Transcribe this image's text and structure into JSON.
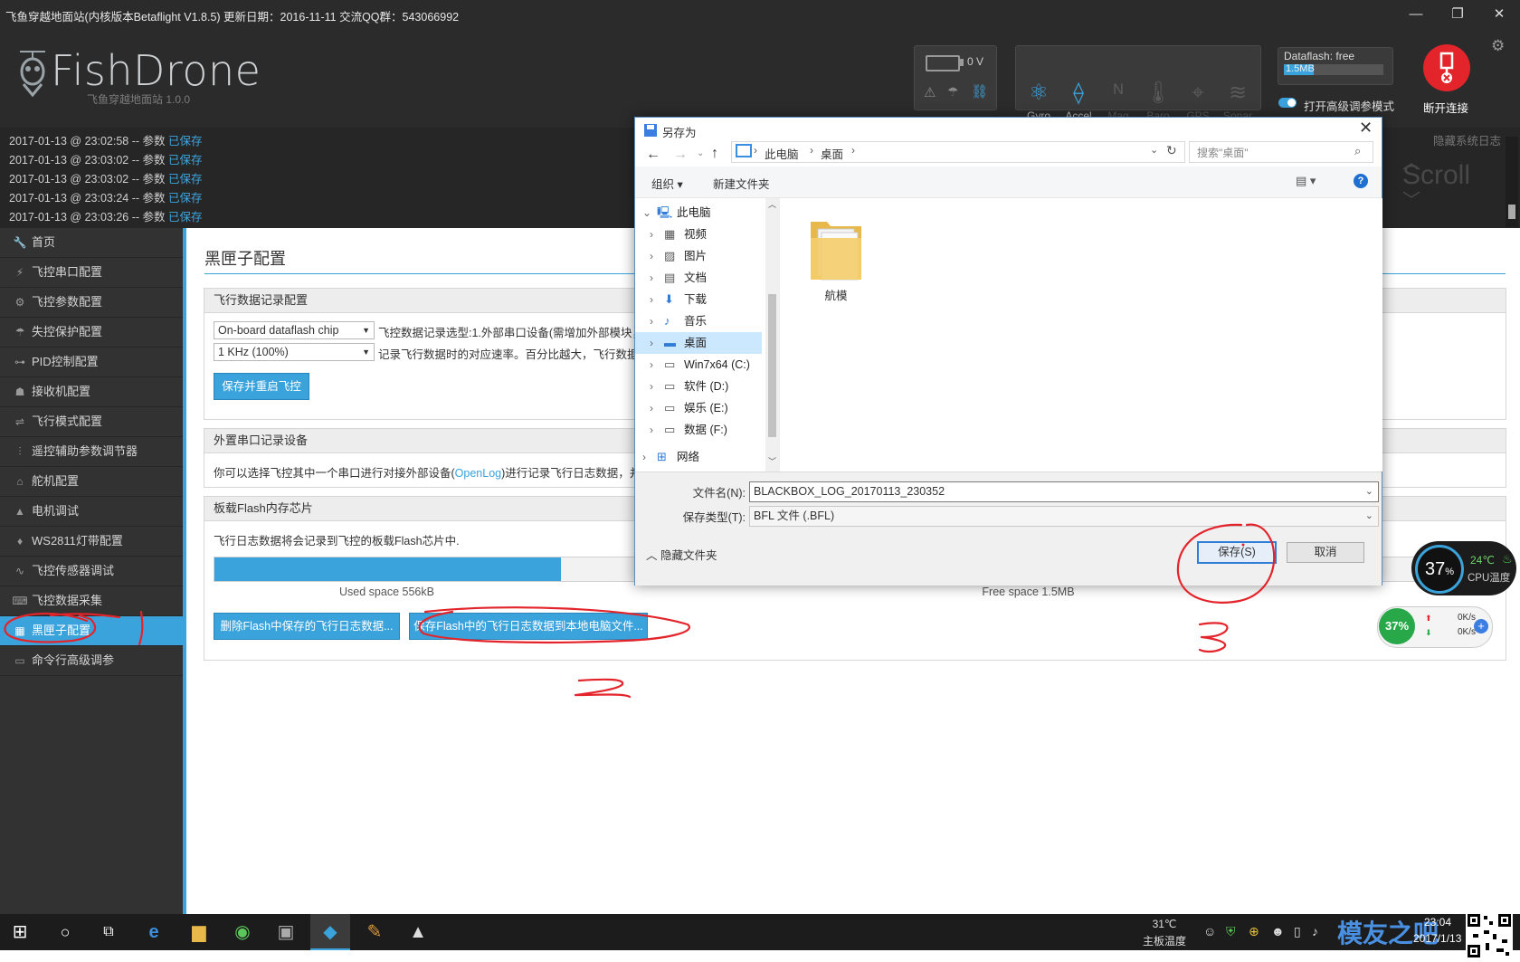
{
  "window": {
    "title": "飞鱼穿越地面站(内核版本Betaflight V1.8.5)   更新日期：2016-11-11  交流QQ群：543066992",
    "minimize": "—",
    "maximize": "❐",
    "close": "✕"
  },
  "header": {
    "logo_text": "FishDrone",
    "logo_sub": "飞鱼穿越地面站     1.0.0",
    "battery_voltage": "0 V",
    "sensors": [
      {
        "label": "Gyro",
        "icon": "gyro-icon",
        "active": true
      },
      {
        "label": "Accel",
        "icon": "accel-icon",
        "active": true
      },
      {
        "label": "Mag",
        "icon": "mag-icon",
        "active": false
      },
      {
        "label": "Baro",
        "icon": "baro-icon",
        "active": false
      },
      {
        "label": "GPS",
        "icon": "gps-icon",
        "active": false
      },
      {
        "label": "Sonar",
        "icon": "sonar-icon",
        "active": false
      }
    ],
    "dataflash_label": "Dataflash: free",
    "dataflash_value": "1.5MB",
    "expert_mode_label": "打开高级调参模式",
    "disconnect_label": "断开连接",
    "hide_log_label": "隐藏系统日志",
    "scroll_label": "Scroll"
  },
  "log": [
    {
      "time": "2017-01-13 @ 23:02:58",
      "text": " -- 参数 ",
      "status": "已保存"
    },
    {
      "time": "2017-01-13 @ 23:03:02",
      "text": " -- 参数 ",
      "status": "已保存"
    },
    {
      "time": "2017-01-13 @ 23:03:02",
      "text": " -- 参数 ",
      "status": "已保存"
    },
    {
      "time": "2017-01-13 @ 23:03:24",
      "text": " -- 参数 ",
      "status": "已保存"
    },
    {
      "time": "2017-01-13 @ 23:03:26",
      "text": " -- 参数 ",
      "status": "已保存"
    }
  ],
  "sidebar": [
    {
      "label": "首页",
      "icon": "wrench-icon"
    },
    {
      "label": "飞控串口配置",
      "icon": "plug-icon"
    },
    {
      "label": "飞控参数配置",
      "icon": "gear-icon"
    },
    {
      "label": "失控保护配置",
      "icon": "parachute-icon"
    },
    {
      "label": "PID控制配置",
      "icon": "sitemap-icon"
    },
    {
      "label": "接收机配置",
      "icon": "robot-icon"
    },
    {
      "label": "飞行模式配置",
      "icon": "toggle-icon"
    },
    {
      "label": "遥控辅助参数调节器",
      "icon": "sliders-icon"
    },
    {
      "label": "舵机配置",
      "icon": "servo-icon"
    },
    {
      "label": "电机调试",
      "icon": "motor-icon"
    },
    {
      "label": "WS2811灯带配置",
      "icon": "led-icon"
    },
    {
      "label": "飞控传感器调试",
      "icon": "pulse-icon"
    },
    {
      "label": "飞控数据采集",
      "icon": "keyboard-icon"
    },
    {
      "label": "黑匣子配置",
      "icon": "blackbox-icon",
      "active": true
    },
    {
      "label": "命令行高级调参",
      "icon": "terminal-icon"
    }
  ],
  "content": {
    "page_title": "黑匣子配置",
    "section1": {
      "title": "飞行数据记录配置",
      "device_select": "On-board dataflash chip",
      "device_desc": "飞控数据记录选型:1.外部串口设备(需增加外部模块，",
      "rate_select": "1 KHz (100%)",
      "rate_desc": "记录飞行数据时的对应速率。百分比越大，飞行数据",
      "save_reboot": "保存并重启飞控"
    },
    "section2": {
      "title": "外置串口记录设备",
      "desc_a": "你可以选择飞控其中一个串口进行对接外部设备(",
      "desc_link": "OpenLog",
      "desc_b": ")进行记录飞行日志数据，并在"
    },
    "section3": {
      "title": "板载Flash内存芯片",
      "desc": "飞行日志数据将会记录到飞控的板载Flash芯片中.",
      "used_fraction": 0.27,
      "used_label": "Used space 556kB",
      "free_label": "Free space 1.5MB",
      "erase_button": "删除Flash中保存的飞行日志数据...",
      "save_button": "保存Flash中的飞行日志数据到本地电脑文件..."
    }
  },
  "dialog": {
    "title": "另存为",
    "path": [
      "此电脑",
      "桌面"
    ],
    "search_placeholder": "搜索\"桌面\"",
    "organize": "组织",
    "new_folder": "新建文件夹",
    "tree": [
      {
        "label": "此电脑",
        "icon": "pc-icon",
        "level": 0,
        "expanded": true
      },
      {
        "label": "视频",
        "icon": "video-icon",
        "level": 1
      },
      {
        "label": "图片",
        "icon": "picture-icon",
        "level": 1
      },
      {
        "label": "文档",
        "icon": "document-icon",
        "level": 1
      },
      {
        "label": "下载",
        "icon": "download-icon",
        "level": 1
      },
      {
        "label": "音乐",
        "icon": "music-icon",
        "level": 1
      },
      {
        "label": "桌面",
        "icon": "desktop-icon",
        "level": 1,
        "selected": true
      },
      {
        "label": "Win7x64 (C:)",
        "icon": "drive-icon",
        "level": 1
      },
      {
        "label": "软件 (D:)",
        "icon": "drive-icon",
        "level": 1
      },
      {
        "label": "娱乐 (E:)",
        "icon": "drive-icon",
        "level": 1
      },
      {
        "label": "数据 (F:)",
        "icon": "drive-icon",
        "level": 1
      },
      {
        "label": "网络",
        "icon": "network-icon",
        "level": 0
      }
    ],
    "folder_name": "航模",
    "filename_label": "文件名(N):",
    "filename_value": "BLACKBOX_LOG_20170113_230352",
    "filetype_label": "保存类型(T):",
    "filetype_value": "BFL 文件 (.BFL)",
    "hide_folders": "隐藏文件夹",
    "save": "保存(S)",
    "cancel": "取消"
  },
  "widgets": {
    "cpu_percent": "37",
    "cpu_unit": "%",
    "cpu_temp": "24℃",
    "cpu_temp_label": "CPU温度",
    "net_percent": "37%",
    "up_speed": "0K/s",
    "down_speed": "0K/s"
  },
  "annotations": [
    "1",
    "2",
    "3"
  ],
  "taskbar": {
    "temp": "31℃",
    "temp_label": "主板温度",
    "time": "23:04",
    "date": "2017/1/13",
    "watermark": "模友之吧"
  },
  "colors": {
    "accent": "#3ba3dc",
    "dark": "#2b2b2b",
    "annotation": "#e3242b"
  }
}
